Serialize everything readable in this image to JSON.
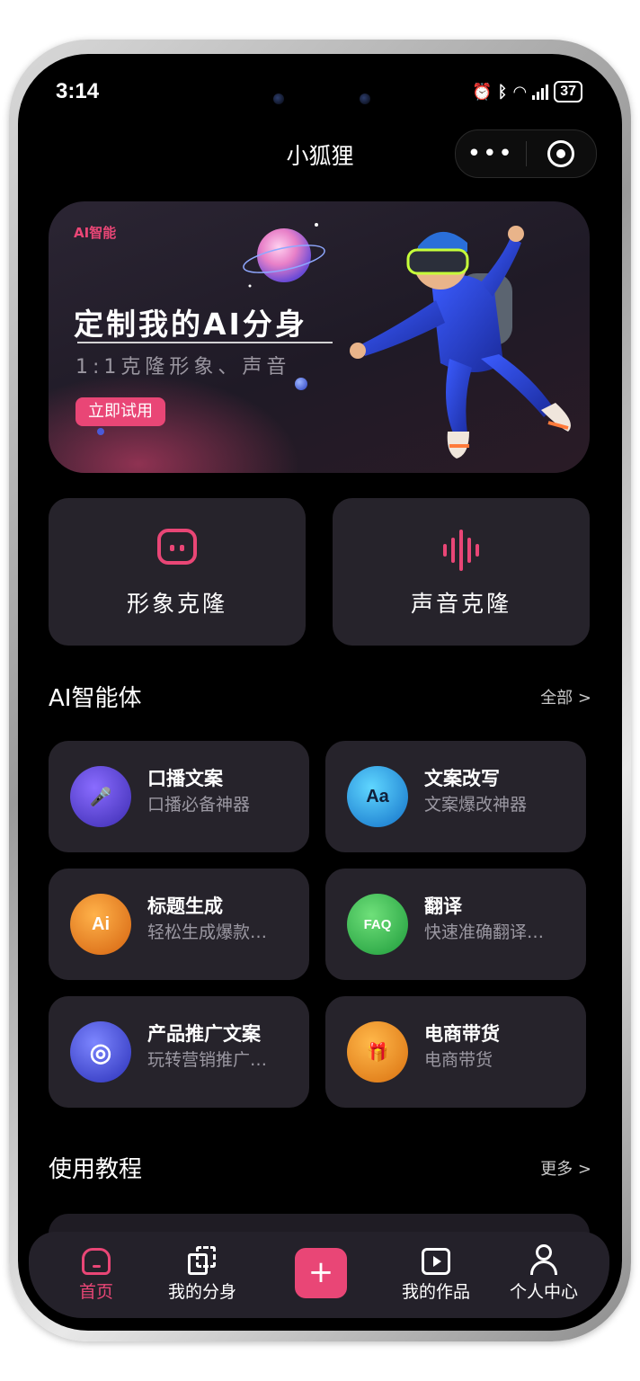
{
  "status_bar": {
    "time": "3:14",
    "battery": "37"
  },
  "header": {
    "title": "小狐狸",
    "more_label": "•••"
  },
  "banner": {
    "tag": "AI智能",
    "heading": "定制我的AI分身",
    "subtitle": "1:1克隆形象、声音",
    "button": "立即试用"
  },
  "clone_cards": [
    {
      "label": "形象克隆",
      "icon": "face-icon"
    },
    {
      "label": "声音克隆",
      "icon": "sound-wave-icon"
    }
  ],
  "agents_section": {
    "title": "AI智能体",
    "more": "全部 >"
  },
  "agents": [
    {
      "name": "口播文案",
      "desc": "口播必备神器",
      "icon": "microphone-icon",
      "color": "#4a3cc4"
    },
    {
      "name": "文案改写",
      "desc": "文案爆改神器",
      "icon": "aa-text-icon",
      "color": "#1f9be0"
    },
    {
      "name": "标题生成",
      "desc": "轻松生成爆款…",
      "icon": "ai-icon",
      "color": "#e87a1f"
    },
    {
      "name": "翻译",
      "desc": "快速准确翻译…",
      "icon": "faq-icon",
      "color": "#2fb34a"
    },
    {
      "name": "产品推广文案",
      "desc": "玩转营销推广…",
      "icon": "target-icon",
      "color": "#3b43c9"
    },
    {
      "name": "电商带货",
      "desc": "电商带货",
      "icon": "gift-icon",
      "color": "#e88a1f"
    }
  ],
  "tutorial_section": {
    "title": "使用教程",
    "more": "更多 >"
  },
  "tabbar": {
    "home": "首页",
    "my_avatar": "我的分身",
    "add": "+",
    "my_works": "我的作品",
    "profile": "个人中心"
  },
  "colors": {
    "accent": "#e94676",
    "card": "#26232b",
    "background": "#000000"
  }
}
